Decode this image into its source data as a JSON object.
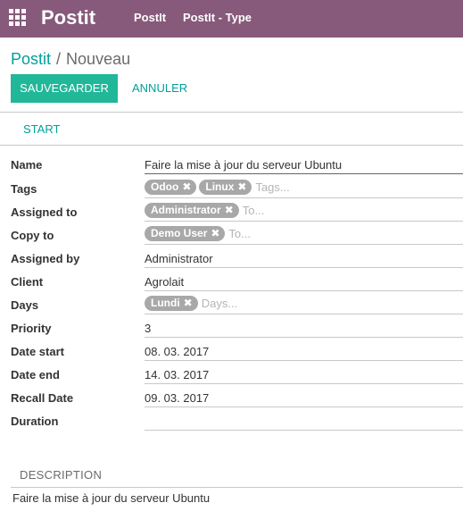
{
  "navbar": {
    "brand": "Postit",
    "menu": [
      "PostIt",
      "PostIt - Type"
    ]
  },
  "breadcrumb": {
    "parent": "Postit",
    "separator": "/",
    "current": "Nouveau"
  },
  "buttons": {
    "save": "SAUVEGARDER",
    "cancel": "ANNULER",
    "start": "START"
  },
  "form": {
    "name": {
      "label": "Name",
      "value": "Faire la mise à jour du serveur Ubuntu"
    },
    "tags": {
      "label": "Tags",
      "items": [
        "Odoo",
        "Linux"
      ],
      "placeholder": "Tags..."
    },
    "assigned_to": {
      "label": "Assigned to",
      "items": [
        "Administrator"
      ],
      "placeholder": "To..."
    },
    "copy_to": {
      "label": "Copy to",
      "items": [
        "Demo User"
      ],
      "placeholder": "To..."
    },
    "assigned_by": {
      "label": "Assigned by",
      "value": "Administrator"
    },
    "client": {
      "label": "Client",
      "value": "Agrolait"
    },
    "days": {
      "label": "Days",
      "items": [
        "Lundi"
      ],
      "placeholder": "Days..."
    },
    "priority": {
      "label": "Priority",
      "value": "3"
    },
    "date_start": {
      "label": "Date start",
      "value": "08. 03. 2017"
    },
    "date_end": {
      "label": "Date end",
      "value": "14. 03. 2017"
    },
    "recall_date": {
      "label": "Recall Date",
      "value": "09. 03. 2017"
    },
    "duration": {
      "label": "Duration",
      "value": ""
    }
  },
  "description": {
    "tab_label": "DESCRIPTION",
    "text": "Faire la mise à jour du serveur Ubuntu"
  },
  "icons": {
    "apps": "grid-icon",
    "remove_tag": "close-icon"
  },
  "colors": {
    "navbar": "#875a7b",
    "primary_button": "#21b799",
    "link": "#00a09d",
    "tag": "#a8a8a8"
  }
}
